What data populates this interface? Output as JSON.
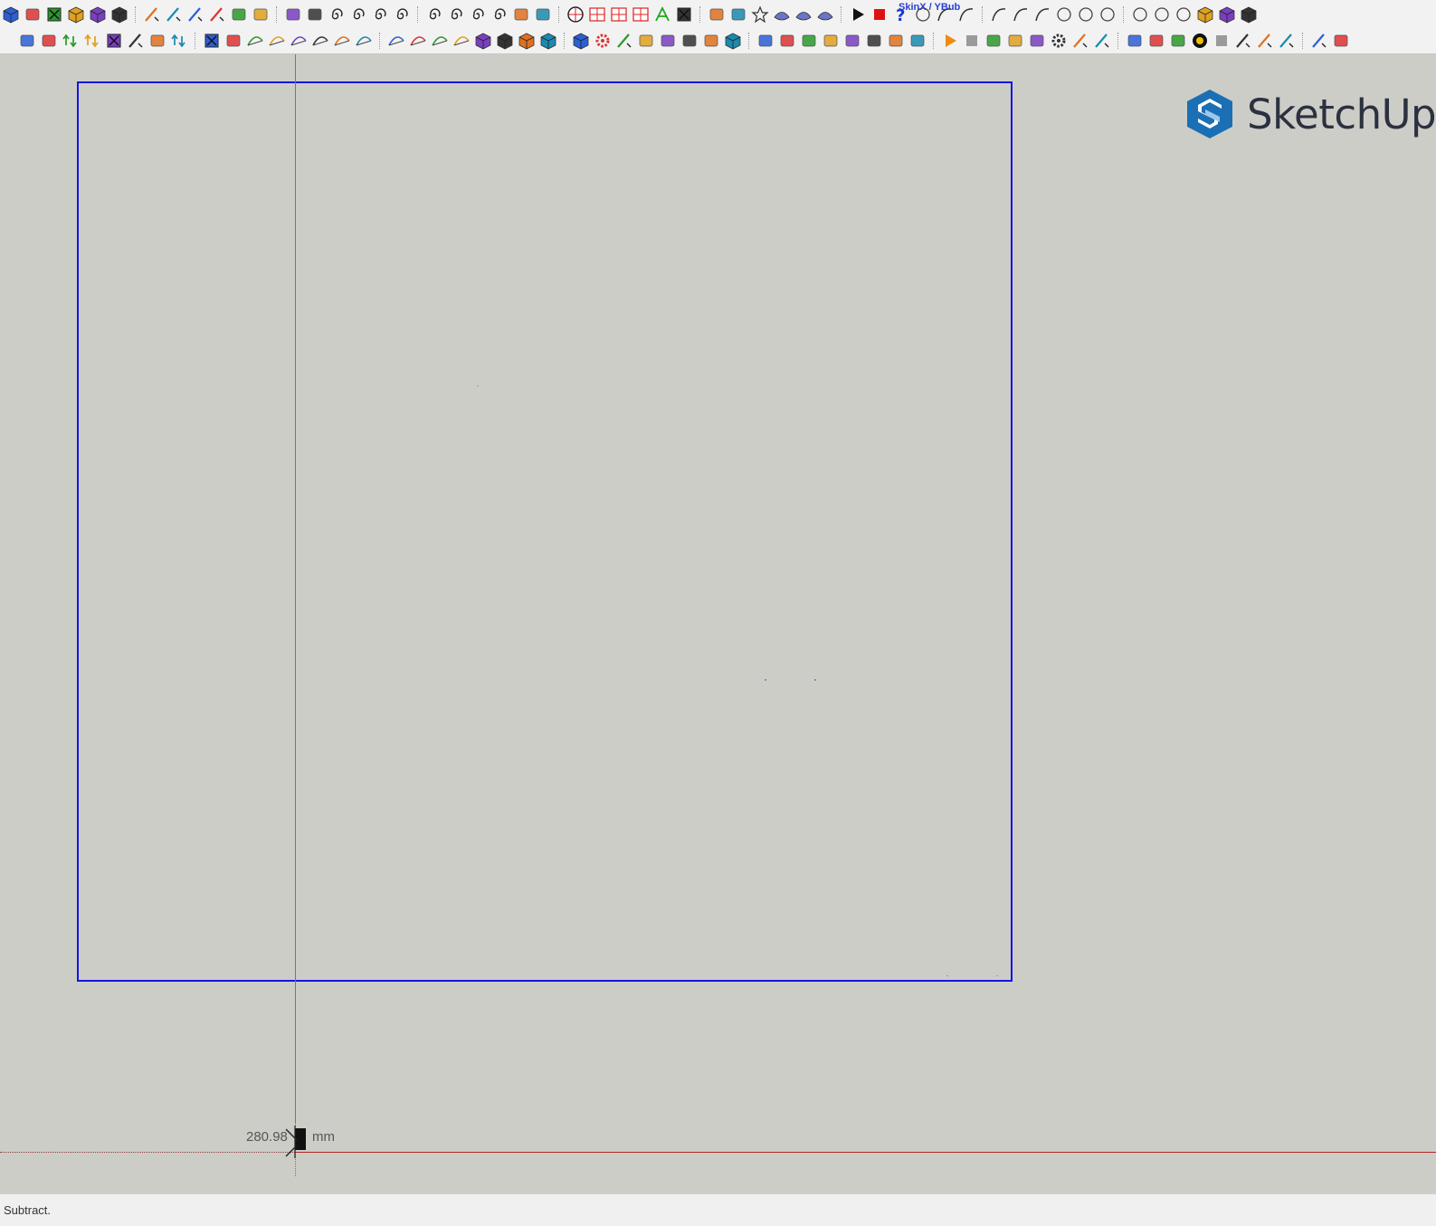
{
  "app": {
    "name": "SketchUp",
    "logo_text": "SketchUp"
  },
  "toolbar": {
    "skinx_label": "SkinX / YBub",
    "row1": [
      "box-blue-icon",
      "pyramid-icon",
      "rotate-red-icon",
      "cube-yellow-icon",
      "cube-white-icon",
      "cube-green-icon",
      "pen-arrow-icon",
      "pen-plus-icon",
      "pen-blue-icon",
      "pen-magenta-icon",
      "angle-green-icon",
      "shield-icon",
      "shapes-icon",
      "mesh-icon",
      "spiral-1-icon",
      "spiral-2-icon",
      "spiral-3-icon",
      "spiral-4-icon",
      "spiral-5-icon",
      "spiral-6-icon",
      "spiral-7-icon",
      "spiral-8-icon",
      "arch-icon",
      "bend-icon",
      "globe-icon",
      "grid-red-1-icon",
      "grid-red-2-icon",
      "grid-red-3-icon",
      "axis-green-icon",
      "lines-red-icon",
      "cylinder-icon",
      "sphere-icon",
      "star-icon",
      "skin-1-icon",
      "skin-2-icon",
      "skin-3-icon",
      "play-icon",
      "stop-red-icon",
      "help-blue-icon",
      "close-circle-icon",
      "curve-1-icon",
      "curve-2-icon",
      "curve-3-icon",
      "curve-4-icon",
      "curve-5-icon",
      "circle-1-icon",
      "circle-2-icon",
      "circle-3-icon",
      "polygon-1-icon",
      "pentagon-icon",
      "ellipse-icon",
      "box-red-icon",
      "box-blue-x-icon",
      "box-black-x-icon"
    ],
    "row2": [
      "sel-1-icon",
      "sel-2-icon",
      "arrow-up-icon",
      "arrows-blue-icon",
      "arrows-red-icon",
      "diag-icon",
      "tri-icon",
      "undo-blue-icon",
      "undo-red-icon",
      "paint-icon",
      "surface-1-icon",
      "surface-2-icon",
      "surface-3-icon",
      "surface-4-icon",
      "surface-5-icon",
      "surface-6-icon",
      "surface-7-icon",
      "surface-8-icon",
      "surface-9-icon",
      "surface-10-icon",
      "solid-1-icon",
      "solid-2-icon",
      "solid-3-icon",
      "solid-4-icon",
      "solid-5-icon",
      "gear-green-icon",
      "knife-icon",
      "frame-icon",
      "follow-icon",
      "paint-bucket-icon",
      "rack-icon",
      "box-orange-icon",
      "cap-icon",
      "wedge-icon",
      "shoe-icon",
      "scissors-icon",
      "snake-icon",
      "scale-1-icon",
      "scale-2-icon",
      "flag-icon",
      "play-orange-icon",
      "stop-gray-icon",
      "prev-icon",
      "hand-icon",
      "pin-icon",
      "gear-pink-icon",
      "ruler-1-icon",
      "ruler-2-icon",
      "chart-icon",
      "eraser-icon",
      "note-icon",
      "record-icon",
      "stop-record-icon",
      "tool-1-icon",
      "tool-2-icon",
      "tool-3-icon",
      "tool-4-icon",
      "window-icon"
    ]
  },
  "measurement": {
    "value": "280.98",
    "unit": "mm"
  },
  "status": {
    "text": "Subtract."
  },
  "colors": {
    "selection": "#1414e6",
    "green_axis": "#2faa2f",
    "red_axis": "#b32222",
    "background": "#cdcdc8",
    "logo_blue": "#1b6fb5",
    "logo_text": "#2c3140"
  }
}
